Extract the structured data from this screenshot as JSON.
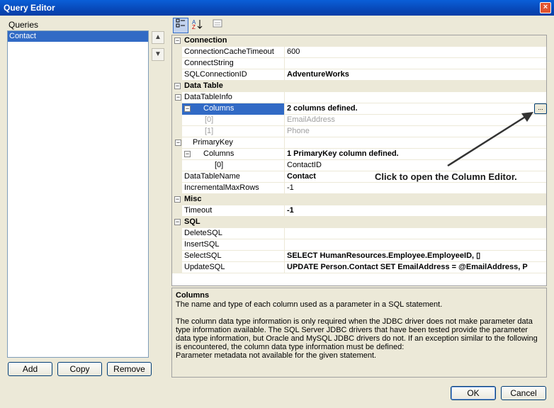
{
  "window": {
    "title": "Query Editor",
    "close_glyph": "×"
  },
  "queries": {
    "label": "Queries",
    "items": [
      "Contact"
    ]
  },
  "buttons": {
    "add": "Add",
    "copy": "Copy",
    "remove": "Remove",
    "ok": "OK",
    "cancel": "Cancel"
  },
  "toolbar": {
    "categorized": "categorized-icon",
    "alphabetical": "sort-az-icon",
    "property_pages": "property-pages-icon"
  },
  "grid": {
    "categories": {
      "connection": "Connection",
      "data_table": "Data Table",
      "misc": "Misc",
      "sql": "SQL"
    },
    "rows": {
      "cache_timeout": {
        "name": "ConnectionCacheTimeout",
        "value": "600"
      },
      "connect_string": {
        "name": "ConnectString",
        "value": ""
      },
      "sql_connection_id": {
        "name": "SQLConnectionID",
        "value": "AdventureWorks"
      },
      "data_table_info": {
        "name": "DataTableInfo",
        "value": ""
      },
      "columns": {
        "name": "Columns",
        "value": "2 columns defined."
      },
      "col0": {
        "name": "[0]",
        "value": "EmailAddress"
      },
      "col1": {
        "name": "[1]",
        "value": "Phone"
      },
      "primary_key": {
        "name": "PrimaryKey",
        "value": ""
      },
      "pk_columns": {
        "name": "Columns",
        "value": "1 PrimaryKey column defined."
      },
      "pk_col0": {
        "name": "[0]",
        "value": "ContactID"
      },
      "data_table_name": {
        "name": "DataTableName",
        "value": "Contact"
      },
      "incremental_max_rows": {
        "name": "IncrementalMaxRows",
        "value": "-1"
      },
      "timeout": {
        "name": "Timeout",
        "value": "-1"
      },
      "delete_sql": {
        "name": "DeleteSQL",
        "value": ""
      },
      "insert_sql": {
        "name": "InsertSQL",
        "value": ""
      },
      "select_sql": {
        "name": "SelectSQL",
        "value": "SELECT HumanResources.Employee.EmployeeID, ▯"
      },
      "update_sql": {
        "name": "UpdateSQL",
        "value": "UPDATE Person.Contact SET EmailAddress = @EmailAddress, P"
      }
    },
    "ellipsis": "..."
  },
  "annotation": "Click to open the Column Editor.",
  "help": {
    "title": "Columns",
    "line1": "The name and type of each column used as a parameter in a SQL statement.",
    "para2": "The column data type information is only required when the JDBC driver does not make parameter data type information available.  The SQL Server JDBC drivers that have been tested provide the parameter data type information, but Oracle and MySQL JDBC drivers do not.  If an exception similar to the following is encountered, the column data type information must be defined:",
    "line3": "Parameter metadata not available for the given statement."
  }
}
